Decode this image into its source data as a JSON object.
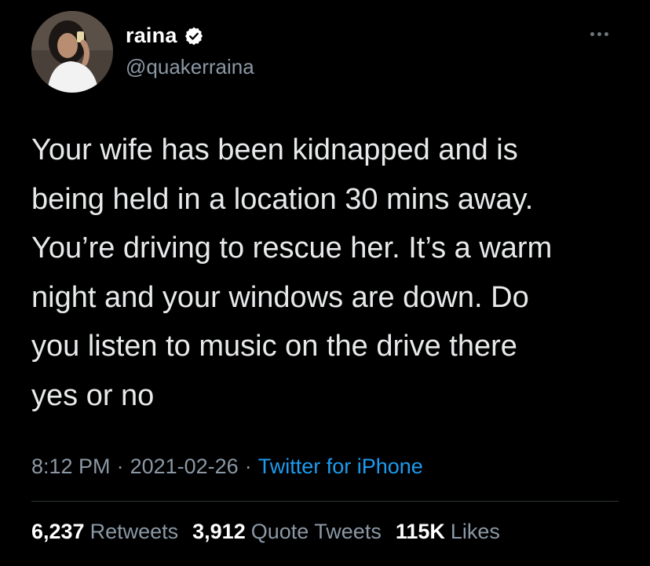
{
  "author": {
    "display_name": "raina",
    "handle": "@quakerraina",
    "verified": true,
    "verified_icon": "verified-badge-icon"
  },
  "more_icon": "more-horizontal-icon",
  "tweet": {
    "text": "Your wife has been kidnapped and is\nbeing held in a location 30 mins away.\nYou’re driving to rescue her. It’s a warm\nnight and your windows are down. Do\nyou listen to music on the drive there\nyes or no"
  },
  "meta": {
    "time": "8:12 PM",
    "separator": "·",
    "date": "2021-02-26",
    "separator2": "·",
    "source": "Twitter for iPhone"
  },
  "stats": {
    "retweets_count": "6,237",
    "retweets_label": "Retweets",
    "quotes_count": "3,912",
    "quotes_label": "Quote Tweets",
    "likes_count": "115K",
    "likes_label": "Likes"
  },
  "colors": {
    "background": "#000000",
    "text": "#e7e9ea",
    "secondary": "#8b98a5",
    "accent": "#1d9bf0"
  }
}
